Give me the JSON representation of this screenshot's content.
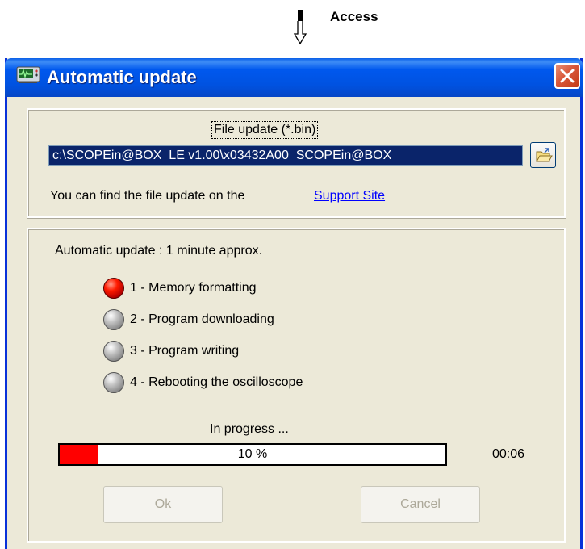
{
  "annotation": {
    "label": "Access"
  },
  "window": {
    "title": "Automatic update"
  },
  "file_section": {
    "label": "File update (*.bin)",
    "path_value": "c:\\SCOPEin@BOX_LE v1.00\\x03432A00_SCOPEin@BOX",
    "info_text": "You can find the file update on the",
    "link_text": "Support Site"
  },
  "update_section": {
    "duration_text": "Automatic update : 1 minute approx.",
    "steps": [
      {
        "label": "1 - Memory formatting",
        "status": "active"
      },
      {
        "label": "2 - Program downloading",
        "status": "pending"
      },
      {
        "label": "3 - Program writing",
        "status": "pending"
      },
      {
        "label": "4 - Rebooting the oscilloscope",
        "status": "pending"
      }
    ],
    "progress_caption": "In progress ...",
    "progress_text": "10 %",
    "progress_fraction": 0.1,
    "elapsed": "00:06"
  },
  "buttons": {
    "ok": "Ok",
    "cancel": "Cancel"
  },
  "icons": {
    "annotation": "arrow-down-icon",
    "app": "oscilloscope-icon",
    "close": "close-icon",
    "browse": "folder-open-icon",
    "step_active": "red-led-icon",
    "step_pending": "gray-led-icon"
  },
  "colors": {
    "title_bar": "#0054e3",
    "progress_fill": "#ff0000",
    "link": "#0000ff",
    "path_highlight": "#0a246a"
  }
}
